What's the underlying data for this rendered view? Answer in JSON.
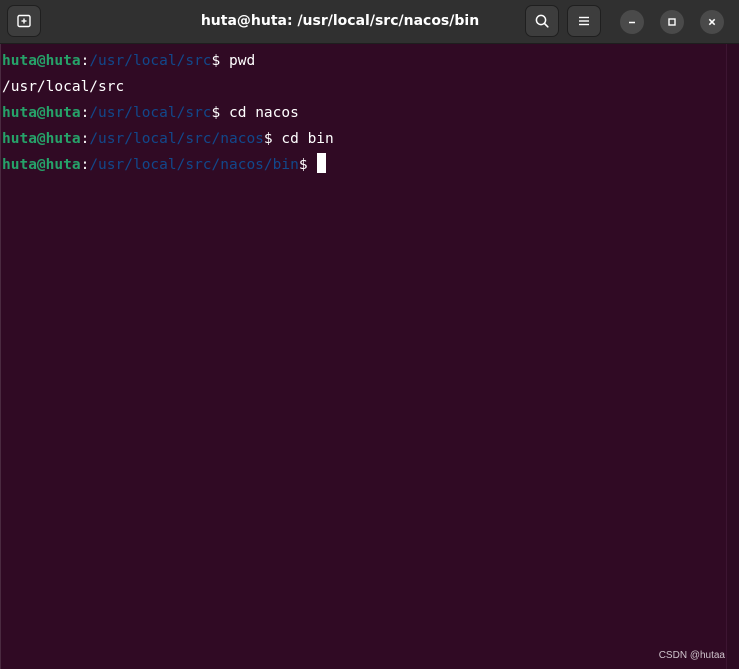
{
  "window": {
    "title": "huta@huta: /usr/local/src/nacos/bin"
  },
  "icons": {
    "new_tab": "new-tab-icon",
    "search": "search-icon",
    "menu": "hamburger-menu-icon",
    "minimize": "minimize-icon",
    "maximize": "maximize-icon",
    "close": "close-icon"
  },
  "terminal": {
    "lines": [
      {
        "type": "prompt",
        "user": "huta@huta",
        "sep": ":",
        "path": "/usr/local/src",
        "prompt": "$ ",
        "command": "pwd"
      },
      {
        "type": "output",
        "text": "/usr/local/src"
      },
      {
        "type": "prompt",
        "user": "huta@huta",
        "sep": ":",
        "path": "/usr/local/src",
        "prompt": "$ ",
        "command": "cd nacos"
      },
      {
        "type": "prompt",
        "user": "huta@huta",
        "sep": ":",
        "path": "/usr/local/src/nacos",
        "prompt": "$ ",
        "command": "cd bin"
      },
      {
        "type": "prompt",
        "user": "huta@huta",
        "sep": ":",
        "path": "/usr/local/src/nacos/bin",
        "prompt": "$ ",
        "command": ""
      }
    ]
  },
  "colors": {
    "background": "#300a24",
    "user": "#26a269",
    "path": "#12488b",
    "text": "#ffffff"
  },
  "watermark": "CSDN @hutaa"
}
